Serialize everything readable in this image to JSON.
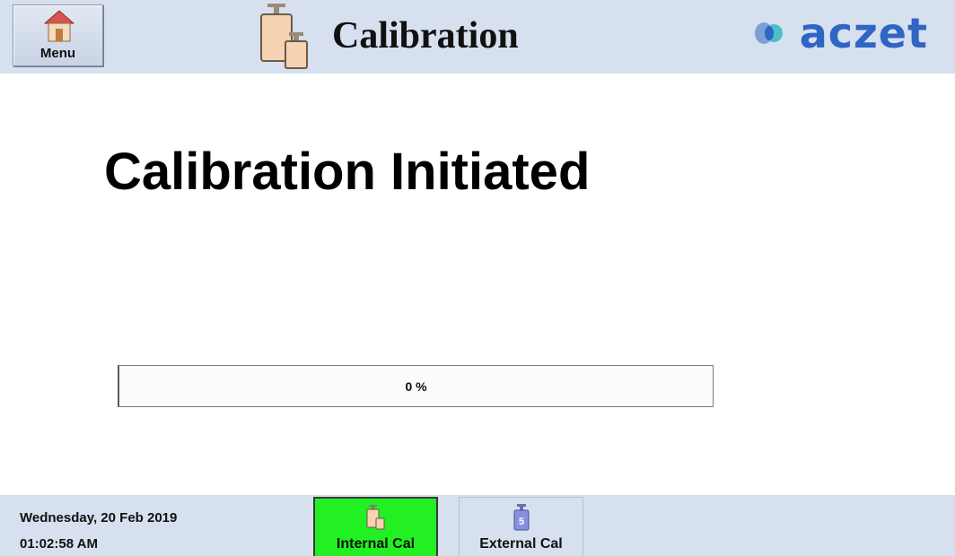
{
  "header": {
    "menu_label": "Menu",
    "title": "Calibration",
    "brand": "aczet"
  },
  "main": {
    "status_title": "Calibration Initiated",
    "progress": {
      "value_percent": 0,
      "label": "0 %"
    }
  },
  "footer": {
    "date": "Wednesday, 20 Feb 2019",
    "time": "01:02:58 AM",
    "tabs": [
      {
        "label": "Internal Cal",
        "icon": "internal-weights-icon",
        "active": true
      },
      {
        "label": "External Cal",
        "icon": "external-weight-icon",
        "active": false
      }
    ]
  },
  "colors": {
    "bar_background": "#d6e0ee",
    "active_tab": "#22f022",
    "brand": "#2f65c4"
  }
}
